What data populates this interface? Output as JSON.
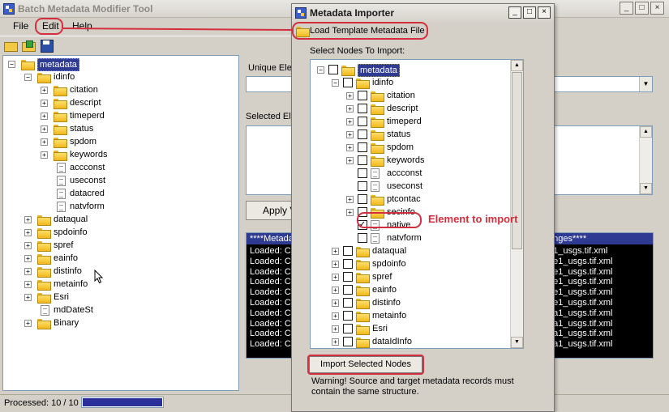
{
  "main": {
    "title": "Batch Metadata Modifier Tool",
    "window_buttons": [
      "_",
      "□",
      "×"
    ],
    "menu": [
      "File",
      "Edit",
      "Help"
    ],
    "tree": [
      {
        "label": "metadata",
        "type": "folder",
        "level": 0,
        "expanded": true,
        "selected": true
      },
      {
        "label": "idinfo",
        "type": "folder",
        "level": 1,
        "expanded": true
      },
      {
        "label": "citation",
        "type": "folder",
        "level": 2,
        "expander": "+"
      },
      {
        "label": "descript",
        "type": "folder",
        "level": 2,
        "expander": "+"
      },
      {
        "label": "timeperd",
        "type": "folder",
        "level": 2,
        "expander": "+"
      },
      {
        "label": "status",
        "type": "folder",
        "level": 2,
        "expander": "+"
      },
      {
        "label": "spdom",
        "type": "folder",
        "level": 2,
        "expander": "+"
      },
      {
        "label": "keywords",
        "type": "folder",
        "level": 2,
        "expander": "+"
      },
      {
        "label": "accconst",
        "type": "doc",
        "level": 2
      },
      {
        "label": "useconst",
        "type": "doc",
        "level": 2
      },
      {
        "label": "datacred",
        "type": "doc",
        "level": 2
      },
      {
        "label": "natvform",
        "type": "doc",
        "level": 2
      },
      {
        "label": "dataqual",
        "type": "folder",
        "level": 1,
        "expander": "+"
      },
      {
        "label": "spdoinfo",
        "type": "folder",
        "level": 1,
        "expander": "+"
      },
      {
        "label": "spref",
        "type": "folder",
        "level": 1,
        "expander": "+"
      },
      {
        "label": "eainfo",
        "type": "folder",
        "level": 1,
        "expander": "+"
      },
      {
        "label": "distinfo",
        "type": "folder",
        "level": 1,
        "expander": "+"
      },
      {
        "label": "metainfo",
        "type": "folder",
        "level": 1,
        "expander": "+"
      },
      {
        "label": "Esri",
        "type": "folder",
        "level": 1,
        "expander": "+"
      },
      {
        "label": "mdDateSt",
        "type": "doc",
        "level": 1
      },
      {
        "label": "Binary",
        "type": "folder",
        "level": 1,
        "expander": "+"
      }
    ],
    "unique_label": "Unique Ele",
    "selected_label": "Selected El",
    "apply_label": "Apply V",
    "log_header_left": "****Metada",
    "log_header_right": "anges****",
    "log_left": [
      "Loaded: C",
      "Loaded: C",
      "Loaded: C",
      "Loaded: C",
      "Loaded: C",
      "Loaded: C",
      "Loaded: C",
      "Loaded: C",
      "Loaded: C",
      "Loaded: C"
    ],
    "log_right": [
      "e1_usgs.tif.xml",
      "2e1_usgs.tif.xml",
      "2e1_usgs.tif.xml",
      "6e1_usgs.tif.xml",
      "5e1_usgs.tif.xml",
      "7e1_usgs.tif.xml",
      "1a1_usgs.tif.xml",
      "5a1_usgs.tif.xml",
      "1a1_usgs.tif.xml",
      "2a1_usgs.tif.xml"
    ],
    "status_text": "Processed: 10 / 10",
    "progress": 1.0
  },
  "dialog": {
    "title": "Metadata Importer",
    "load_label": "Load Template Metadata File",
    "select_label": "Select Nodes To Import:",
    "tree": [
      {
        "label": "metadata",
        "type": "folder",
        "level": 0,
        "expander": "-",
        "checked": false,
        "selected": true
      },
      {
        "label": "idinfo",
        "type": "folder",
        "level": 1,
        "expander": "-",
        "checked": false
      },
      {
        "label": "citation",
        "type": "folder",
        "level": 2,
        "expander": "+",
        "checked": false
      },
      {
        "label": "descript",
        "type": "folder",
        "level": 2,
        "expander": "+",
        "checked": false
      },
      {
        "label": "timeperd",
        "type": "folder",
        "level": 2,
        "expander": "+",
        "checked": false
      },
      {
        "label": "status",
        "type": "folder",
        "level": 2,
        "expander": "+",
        "checked": false
      },
      {
        "label": "spdom",
        "type": "folder",
        "level": 2,
        "expander": "+",
        "checked": false
      },
      {
        "label": "keywords",
        "type": "folder",
        "level": 2,
        "expander": "+",
        "checked": false
      },
      {
        "label": "accconst",
        "type": "doc",
        "level": 2,
        "checked": false
      },
      {
        "label": "useconst",
        "type": "doc",
        "level": 2,
        "checked": false
      },
      {
        "label": "ptcontac",
        "type": "folder",
        "level": 2,
        "expander": "+",
        "checked": false
      },
      {
        "label": "secinfo",
        "type": "folder",
        "level": 2,
        "expander": "+",
        "checked": false
      },
      {
        "label": "native",
        "type": "doc",
        "level": 2,
        "checked": true
      },
      {
        "label": "natvform",
        "type": "doc",
        "level": 2,
        "checked": false
      },
      {
        "label": "dataqual",
        "type": "folder",
        "level": 1,
        "expander": "+",
        "checked": false
      },
      {
        "label": "spdoinfo",
        "type": "folder",
        "level": 1,
        "expander": "+",
        "checked": false
      },
      {
        "label": "spref",
        "type": "folder",
        "level": 1,
        "expander": "+",
        "checked": false
      },
      {
        "label": "eainfo",
        "type": "folder",
        "level": 1,
        "expander": "+",
        "checked": false
      },
      {
        "label": "distinfo",
        "type": "folder",
        "level": 1,
        "expander": "+",
        "checked": false
      },
      {
        "label": "metainfo",
        "type": "folder",
        "level": 1,
        "expander": "+",
        "checked": false
      },
      {
        "label": "Esri",
        "type": "folder",
        "level": 1,
        "expander": "+",
        "checked": false
      },
      {
        "label": "dataIdInfo",
        "type": "folder",
        "level": 1,
        "expander": "+",
        "checked": false
      }
    ],
    "import_label": "Import Selected Nodes",
    "warning": "Warning!  Source and target metadata records must contain the same structure.",
    "window_buttons": [
      "_",
      "□",
      "×"
    ]
  },
  "annotation": {
    "text": "Element to import",
    "color": "#d32f3e"
  },
  "colors": {
    "selection": "#2f3a93",
    "progress": "#2a2f9a",
    "folder": "#f0b91e"
  }
}
